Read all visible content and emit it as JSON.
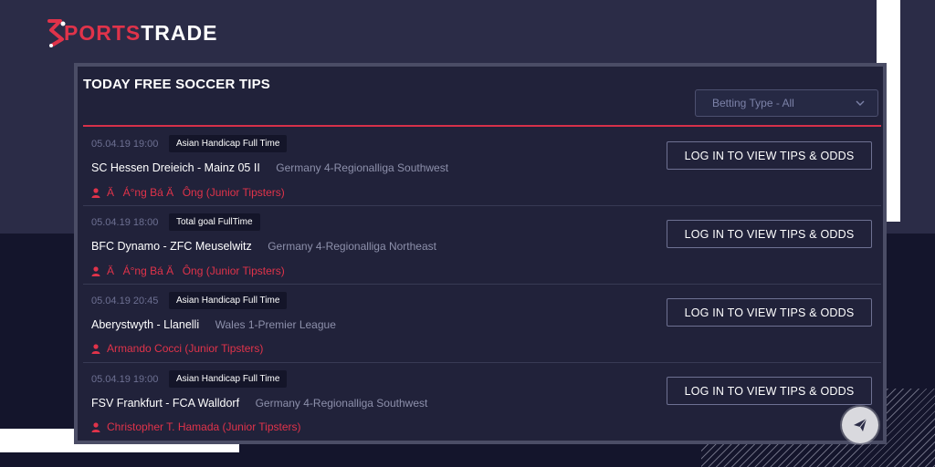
{
  "brand": {
    "prefix": "S",
    "name_accent": "PORTS",
    "name_rest": "TRADE",
    "accent_color": "#e0334a"
  },
  "panel": {
    "title": "TODAY FREE SOCCER TIPS",
    "betting_type_select": {
      "value": "Betting Type - All"
    }
  },
  "tips": [
    {
      "datetime": "05.04.19 19:00",
      "bet_type": "Asian Handicap Full Time",
      "match": "SC Hessen Dreieich - Mainz 05 II",
      "league": "Germany 4-Regionalliga Southwest",
      "tipster": "ÄÁ°ng Bá ÄÔng (Junior Tipsters)",
      "button_label": "LOG IN TO VIEW TIPS & ODDS"
    },
    {
      "datetime": "05.04.19 18:00",
      "bet_type": "Total goal FullTime",
      "match": "BFC Dynamo - ZFC Meuselwitz",
      "league": "Germany 4-Regionalliga Northeast",
      "tipster": "ÄÁ°ng Bá ÄÔng (Junior Tipsters)",
      "button_label": "LOG IN TO VIEW TIPS & ODDS"
    },
    {
      "datetime": "05.04.19 20:45",
      "bet_type": "Asian Handicap Full Time",
      "match": "Aberystwyth - Llanelli",
      "league": "Wales 1-Premier League",
      "tipster": "Armando Cocci (Junior Tipsters)",
      "button_label": "LOG IN TO VIEW TIPS & ODDS"
    },
    {
      "datetime": "05.04.19 19:00",
      "bet_type": "Asian Handicap Full Time",
      "match": "FSV Frankfurt - FCA Walldorf",
      "league": "Germany 4-Regionalliga Southwest",
      "tipster": "Christopher T. Hamada (Junior Tipsters)",
      "button_label": "LOG IN TO VIEW TIPS & ODDS"
    }
  ],
  "icons": {
    "select": "chevron-down-icon",
    "tipster": "user-icon",
    "fab": "paper-plane-icon"
  }
}
